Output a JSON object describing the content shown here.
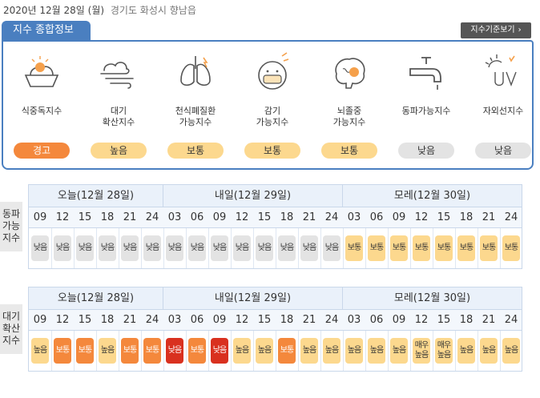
{
  "header": {
    "date": "2020년 12월 28일 (월)",
    "location": "경기도 화성시 향남읍"
  },
  "tab_title": "지수 종합정보",
  "std_button": "지수기준보기",
  "std_button_arrow": "›",
  "summary": [
    {
      "name": "food",
      "icon": "food-poisoning-icon",
      "label1": "식중독지수",
      "label2": "",
      "status": "경고",
      "level": "warn"
    },
    {
      "name": "air",
      "icon": "wind-icon",
      "label1": "대기",
      "label2": "확산지수",
      "status": "높음",
      "level": "high"
    },
    {
      "name": "asthma",
      "icon": "lungs-icon",
      "label1": "천식폐질환",
      "label2": "가능지수",
      "status": "보통",
      "level": "normal"
    },
    {
      "name": "cold",
      "icon": "mask-icon",
      "label1": "감기",
      "label2": "가능지수",
      "status": "보통",
      "level": "normal"
    },
    {
      "name": "stroke",
      "icon": "brain-icon",
      "label1": "뇌졸중",
      "label2": "가능지수",
      "status": "보통",
      "level": "normal"
    },
    {
      "name": "freeze",
      "icon": "faucet-icon",
      "label1": "동파가능지수",
      "label2": "",
      "status": "낮음",
      "level": "low"
    },
    {
      "name": "uv",
      "icon": "uv-icon",
      "label1": "자외선지수",
      "label2": "",
      "status": "낮음",
      "level": "low"
    }
  ],
  "grids": [
    {
      "label": [
        "동파",
        "가능",
        "지수"
      ],
      "days": [
        "오늘(12월 28일)",
        "내일(12월 29일)",
        "모레(12월 30일)"
      ],
      "hours": [
        "09",
        "12",
        "15",
        "18",
        "21",
        "24",
        "03",
        "06",
        "09",
        "12",
        "15",
        "18",
        "21",
        "24",
        "03",
        "06",
        "09",
        "12",
        "15",
        "18",
        "21",
        "24"
      ],
      "values": [
        {
          "t": "낮음",
          "c": "low"
        },
        {
          "t": "낮음",
          "c": "low"
        },
        {
          "t": "낮음",
          "c": "low"
        },
        {
          "t": "낮음",
          "c": "low"
        },
        {
          "t": "낮음",
          "c": "low"
        },
        {
          "t": "낮음",
          "c": "low"
        },
        {
          "t": "낮음",
          "c": "low"
        },
        {
          "t": "낮음",
          "c": "low"
        },
        {
          "t": "낮음",
          "c": "low"
        },
        {
          "t": "낮음",
          "c": "low"
        },
        {
          "t": "낮음",
          "c": "low"
        },
        {
          "t": "낮음",
          "c": "low"
        },
        {
          "t": "낮음",
          "c": "low"
        },
        {
          "t": "낮음",
          "c": "low"
        },
        {
          "t": "보통",
          "c": "normal"
        },
        {
          "t": "보통",
          "c": "normal"
        },
        {
          "t": "보통",
          "c": "normal"
        },
        {
          "t": "보통",
          "c": "normal"
        },
        {
          "t": "보통",
          "c": "normal"
        },
        {
          "t": "보통",
          "c": "normal"
        },
        {
          "t": "보통",
          "c": "normal"
        },
        {
          "t": "보통",
          "c": "normal"
        }
      ]
    },
    {
      "label": [
        "대기",
        "확산",
        "지수"
      ],
      "days": [
        "오늘(12월 28일)",
        "내일(12월 29일)",
        "모레(12월 30일)"
      ],
      "hours": [
        "09",
        "12",
        "15",
        "18",
        "21",
        "24",
        "03",
        "06",
        "09",
        "12",
        "15",
        "18",
        "21",
        "24",
        "03",
        "06",
        "09",
        "12",
        "15",
        "18",
        "21",
        "24"
      ],
      "values": [
        {
          "t": "높음",
          "c": "high"
        },
        {
          "t": "보통",
          "c": "bad"
        },
        {
          "t": "보통",
          "c": "bad"
        },
        {
          "t": "높음",
          "c": "high"
        },
        {
          "t": "보통",
          "c": "bad"
        },
        {
          "t": "보통",
          "c": "bad"
        },
        {
          "t": "낮음",
          "c": "red"
        },
        {
          "t": "보통",
          "c": "bad"
        },
        {
          "t": "낮음",
          "c": "red"
        },
        {
          "t": "높음",
          "c": "high"
        },
        {
          "t": "높음",
          "c": "high"
        },
        {
          "t": "보통",
          "c": "bad"
        },
        {
          "t": "높음",
          "c": "high"
        },
        {
          "t": "높음",
          "c": "high"
        },
        {
          "t": "높음",
          "c": "high"
        },
        {
          "t": "높음",
          "c": "high"
        },
        {
          "t": "높음",
          "c": "high"
        },
        {
          "t": "매우 높음",
          "c": "vhigh"
        },
        {
          "t": "매우 높음",
          "c": "vhigh"
        },
        {
          "t": "높음",
          "c": "high"
        },
        {
          "t": "높음",
          "c": "high"
        },
        {
          "t": "높음",
          "c": "high"
        }
      ]
    }
  ]
}
